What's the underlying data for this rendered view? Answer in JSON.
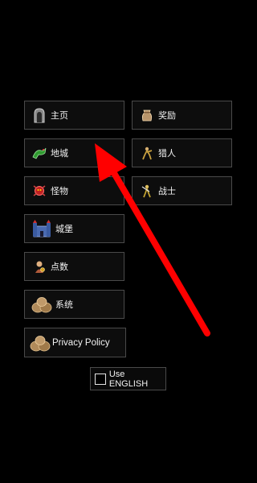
{
  "menu": {
    "home": "主页",
    "rewards": "奖励",
    "dungeon": "地城",
    "hunter": "猎人",
    "monsters": "怪物",
    "warrior": "战士",
    "castle": "城堡",
    "points": "点数",
    "system": "系统",
    "privacy_policy": "Privacy Policy"
  },
  "language_toggle": {
    "label": "Use ENGLISH",
    "checked": false
  },
  "annotation": {
    "arrow_color": "#ff0000"
  },
  "icons": {
    "home": "stone-portal-icon",
    "rewards": "treasure-sack-icon",
    "dungeon": "green-dragon-icon",
    "hunter": "hunter-figure-icon",
    "monsters": "red-monster-icon",
    "warrior": "warrior-figure-icon",
    "castle": "castle-icon",
    "points": "coin-figure-icon",
    "system": "sacks-icon",
    "privacy_policy": "sacks-icon"
  }
}
